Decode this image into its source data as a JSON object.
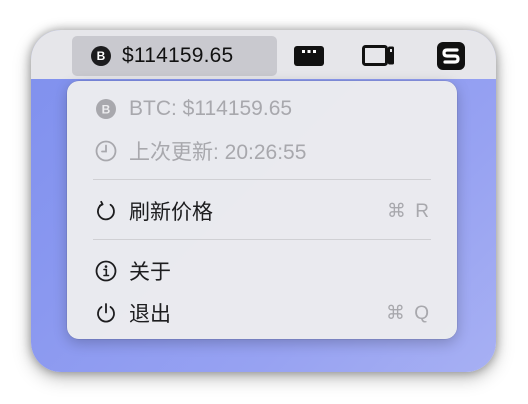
{
  "menubar": {
    "status_badge_letter": "B",
    "status_price": "$114159.65",
    "icons": [
      "window-dots-icon",
      "display-window-icon",
      "s-app-icon"
    ]
  },
  "menu": {
    "info_price": "BTC: $114159.65",
    "info_updated": "上次更新: 20:26:55",
    "refresh_label": "刷新价格",
    "refresh_shortcut": "⌘ R",
    "about_label": "关于",
    "quit_label": "退出",
    "quit_shortcut": "⌘ Q"
  },
  "colors": {
    "wallpaper": "#8a98f0",
    "menubar": "#e6e6ea",
    "highlight": "#c9c9cf",
    "menu_bg": "#ececee",
    "disabled_text": "#a8a8ad"
  }
}
